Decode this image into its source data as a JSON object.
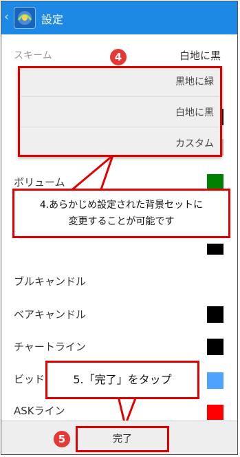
{
  "header": {
    "back_glyph": "‹",
    "title": "設定",
    "logo_icon": "app-logo-icon"
  },
  "scheme": {
    "label": "スキーム",
    "value": "白地に黒"
  },
  "dropdown": {
    "options": [
      "黒地に緑",
      "白地に黒",
      "カスタム"
    ]
  },
  "settings": [
    {
      "label": "ボリューム",
      "color": "#008000"
    },
    {
      "label": "ブルキャンドル",
      "color": ""
    },
    {
      "label": "ベアキャンドル",
      "color": "#000000"
    },
    {
      "label": "チャートライン",
      "color": "#000000"
    },
    {
      "label": "ビッド",
      "color": "#4da3ff"
    },
    {
      "label": "ASKライン",
      "color": "#ff0000"
    }
  ],
  "annotations": {
    "badge4": "4",
    "callout4_line1": "4.あらかじめ設定された背景セットに",
    "callout4_line2": "変更することが可能です",
    "badge5": "5",
    "callout5": "5.「完了」をタップ"
  },
  "footer": {
    "done_label": "完了"
  }
}
